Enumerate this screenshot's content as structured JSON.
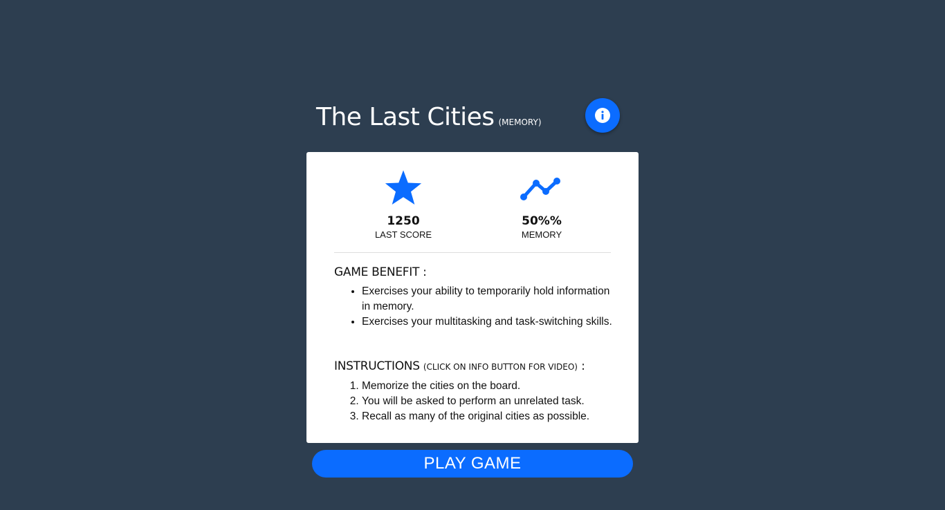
{
  "header": {
    "title": "The Last Cities",
    "category": "(MEMORY)",
    "info_icon": "info-icon"
  },
  "stats": [
    {
      "icon": "star-icon",
      "value": "1250",
      "label": "LAST SCORE"
    },
    {
      "icon": "trend-line-icon",
      "value": "50%%",
      "label": "MEMORY"
    }
  ],
  "benefit": {
    "heading": "GAME BENEFIT :",
    "items": [
      "Exercises your ability to temporarily hold information in memory.",
      "Exercises your multitasking and task-switching skills."
    ]
  },
  "instructions": {
    "heading": "INSTRUCTIONS",
    "heading_note": "(CLICK ON INFO BUTTON FOR VIDEO)",
    "heading_suffix": " :",
    "steps": [
      "Memorize the cities on the board.",
      "You will be asked to perform an unrelated task.",
      "Recall as many of the original cities as possible."
    ]
  },
  "play_button": {
    "label": "PLAY GAME"
  },
  "colors": {
    "background": "#2d3e50",
    "accent": "#0b6cff",
    "card": "#ffffff"
  }
}
